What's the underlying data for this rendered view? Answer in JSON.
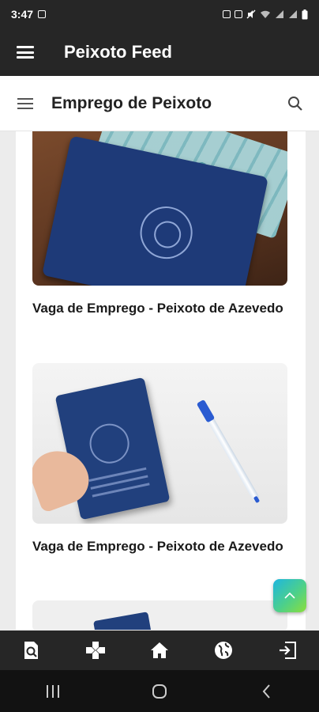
{
  "status_bar": {
    "time": "3:47"
  },
  "app_bar": {
    "title": "Peixoto Feed",
    "menu_icon": "hamburger-icon"
  },
  "page_header": {
    "title": "Emprego de Peixoto",
    "menu_icon": "hamburger-icon",
    "search_icon": "search-icon"
  },
  "posts": [
    {
      "title": "Vaga de Emprego - Peixoto de Azevedo",
      "image": "work-card-with-money"
    },
    {
      "title": "Vaga de Emprego - Peixoto de Azevedo",
      "image": "work-card-with-pen"
    }
  ],
  "fab": {
    "icon": "chevron-up-icon"
  },
  "bottom_nav": {
    "items": [
      {
        "icon": "search-document-icon"
      },
      {
        "icon": "gamepad-icon"
      },
      {
        "icon": "home-icon"
      },
      {
        "icon": "globe-icon"
      },
      {
        "icon": "exit-icon"
      }
    ]
  },
  "system_nav": {
    "recents": "recents-icon",
    "home": "home-circle-icon",
    "back": "back-icon"
  },
  "colors": {
    "bar": "#262626",
    "accent_from": "#1eb6e0",
    "accent_to": "#8bde3c"
  }
}
